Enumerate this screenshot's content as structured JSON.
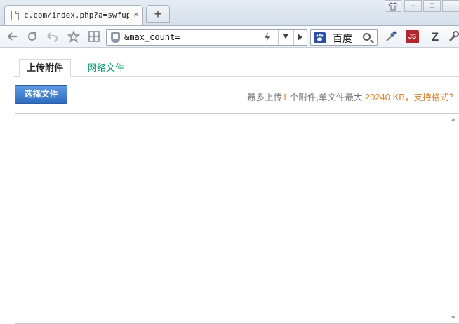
{
  "browser": {
    "tab": {
      "title": "c.com/index.php?a=swfupl",
      "close_glyph": "×"
    },
    "new_tab_glyph": "+",
    "window_controls": {
      "skin_icon": "shirt-icon",
      "minimize": "–",
      "maximize": "□"
    },
    "nav_icons": [
      "back-icon",
      "reload-icon",
      "undo-icon",
      "favorites-icon",
      "grid-icon"
    ],
    "address": {
      "value": "&max_count=",
      "speed_icon": "bolt-icon"
    },
    "search": {
      "engine_name": "百度",
      "engine_icon": "baidu-paw-icon"
    },
    "extensions": {
      "js_label": "JS",
      "z_label": "Z",
      "eyedropper_icon": "eyedropper-icon",
      "settings_icon": "wrench-icon"
    }
  },
  "page": {
    "tabs": [
      {
        "label": "上传附件",
        "active": true
      },
      {
        "label": "网络文件",
        "active": false
      }
    ],
    "select_button": "选择文件",
    "info": {
      "prefix": "最多上传",
      "max_files": "1",
      "middle": " 个附件,单文件最大",
      "max_size": "20240 KB",
      "comma": "，",
      "formats_link": "支持格式？"
    }
  },
  "colors": {
    "accent_green": "#0a9a6a",
    "highlight_orange": "#d9822b",
    "button_blue": "#3b7bd0"
  }
}
